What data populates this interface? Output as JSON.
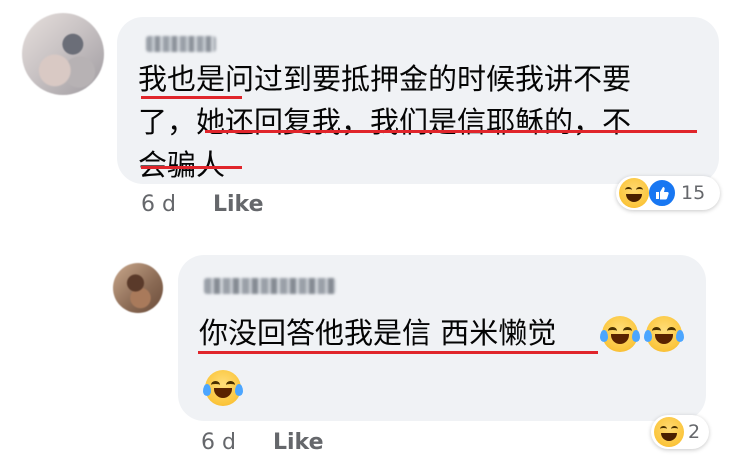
{
  "comments": [
    {
      "lines": [
        "我也是问过到要抵押金的时候我讲不要",
        "了，她还回复我，我们是信耶稣的，不",
        "会骗人"
      ],
      "reactions": {
        "icons": [
          "haha-icon",
          "like-icon"
        ],
        "count": "15"
      },
      "time": "6 d",
      "like_label": "Like"
    },
    {
      "lines": [
        "你没回答他我是信 西米懒觉"
      ],
      "reactions": {
        "icons": [
          "haha-icon"
        ],
        "count": "2"
      },
      "time": "6 d",
      "like_label": "Like"
    }
  ],
  "colors": {
    "bubble": "#f0f2f5",
    "underline": "#e0252b",
    "like_blue": "#1877f2",
    "meta_text": "#65676b"
  }
}
